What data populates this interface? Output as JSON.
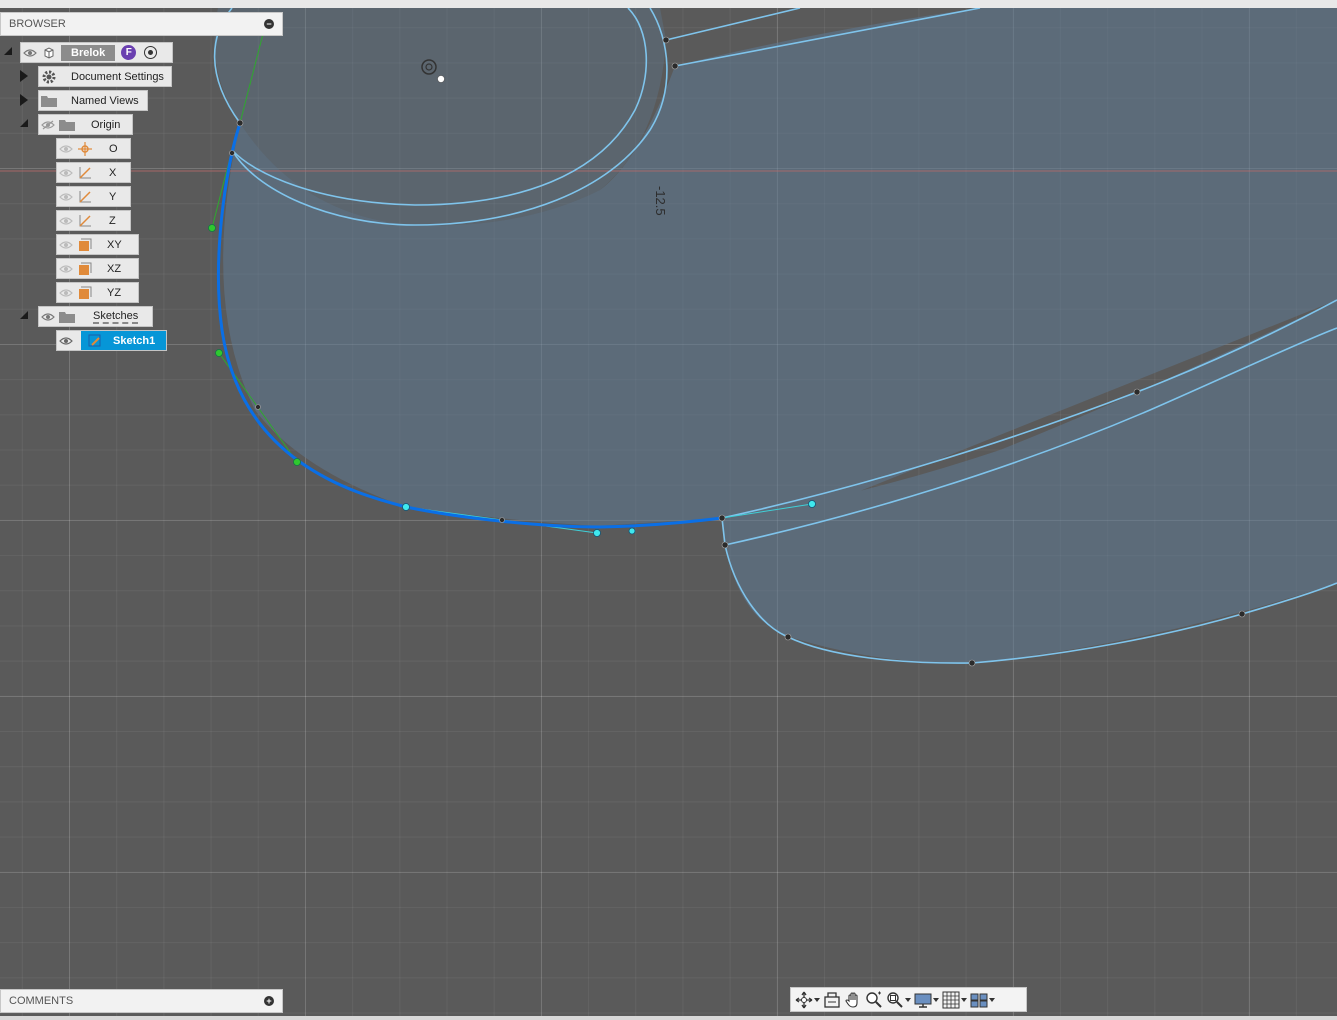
{
  "browser": {
    "title": "BROWSER",
    "root": {
      "label": "Brelok"
    },
    "items": [
      {
        "label": "Document Settings"
      },
      {
        "label": "Named Views"
      },
      {
        "label": "Origin"
      }
    ],
    "origin_children": [
      {
        "label": "O",
        "icon": "origin-point-icon"
      },
      {
        "label": "X",
        "icon": "axis-icon"
      },
      {
        "label": "Y",
        "icon": "axis-icon"
      },
      {
        "label": "Z",
        "icon": "axis-icon"
      },
      {
        "label": "XY",
        "icon": "plane-icon"
      },
      {
        "label": "XZ",
        "icon": "plane-icon"
      },
      {
        "label": "YZ",
        "icon": "plane-icon"
      }
    ],
    "sketches": {
      "label": "Sketches"
    },
    "sketch1": {
      "label": "Sketch1"
    }
  },
  "comments": {
    "title": "COMMENTS"
  },
  "viewport": {
    "dimension_label": "-12.5",
    "colors": {
      "sketch_line": "#7fc4ec",
      "active_spline": "#0a6fe6",
      "handle_line": "#2fa82f",
      "background": "#5a5a5a",
      "profile_fill": "#5f7a94"
    }
  },
  "toolbar": {
    "tools": [
      "orbit-icon",
      "look-at-icon",
      "pan-icon",
      "zoom-icon",
      "fit-icon",
      "display-settings-icon",
      "grid-settings-icon",
      "viewports-icon"
    ]
  }
}
